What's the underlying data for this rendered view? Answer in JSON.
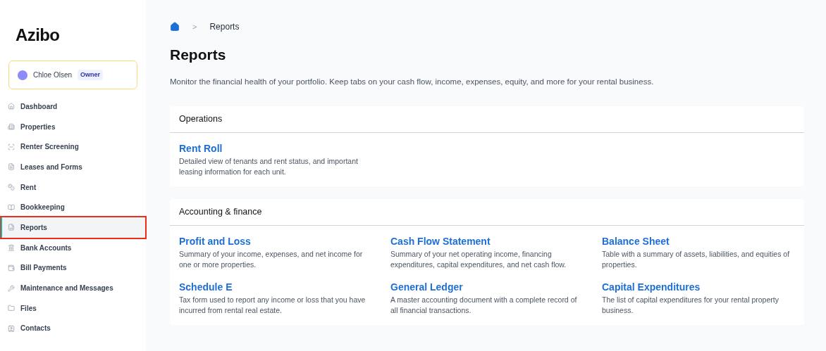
{
  "logo": "Azibo",
  "user": {
    "name": "Chloe Olsen",
    "role": "Owner"
  },
  "sidebar": {
    "items": [
      {
        "label": "Dashboard",
        "selected": false,
        "highlighted": false
      },
      {
        "label": "Properties",
        "selected": false,
        "highlighted": false
      },
      {
        "label": "Renter Screening",
        "selected": false,
        "highlighted": false
      },
      {
        "label": "Leases and Forms",
        "selected": false,
        "highlighted": false
      },
      {
        "label": "Rent",
        "selected": false,
        "highlighted": false
      },
      {
        "label": "Bookkeeping",
        "selected": false,
        "highlighted": false
      },
      {
        "label": "Reports",
        "selected": true,
        "highlighted": true
      },
      {
        "label": "Bank Accounts",
        "selected": false,
        "highlighted": false
      },
      {
        "label": "Bill Payments",
        "selected": false,
        "highlighted": false
      },
      {
        "label": "Maintenance and Messages",
        "selected": false,
        "highlighted": false
      },
      {
        "label": "Files",
        "selected": false,
        "highlighted": false
      },
      {
        "label": "Contacts",
        "selected": false,
        "highlighted": false
      }
    ]
  },
  "breadcrumb": {
    "separator": ">",
    "current": "Reports"
  },
  "title": "Reports",
  "description": "Monitor the financial health of your portfolio. Keep tabs on your cash flow, income, expenses, equity, and more for your rental business.",
  "sections": [
    {
      "title": "Operations",
      "reports": [
        {
          "name": "Rent Roll",
          "description": "Detailed view of tenants and rent status, and important leasing information for each unit."
        }
      ]
    },
    {
      "title": "Accounting & finance",
      "reports": [
        {
          "name": "Profit and Loss",
          "description": "Summary of your income, expenses, and net income for one or more properties."
        },
        {
          "name": "Cash Flow Statement",
          "description": "Summary of your net operating income, financing expenditures, capital expenditures, and net cash flow."
        },
        {
          "name": "Balance Sheet",
          "description": "Table with a summary of assets, liabilities, and equities of properties."
        },
        {
          "name": "Schedule E",
          "description": "Tax form used to report any income or loss that you have incurred from rental real estate."
        },
        {
          "name": "General Ledger",
          "description": "A master accounting document with a complete record of all financial transactions."
        },
        {
          "name": "Capital Expenditures",
          "description": "The list of capital expenditures for your rental property business."
        }
      ]
    }
  ]
}
